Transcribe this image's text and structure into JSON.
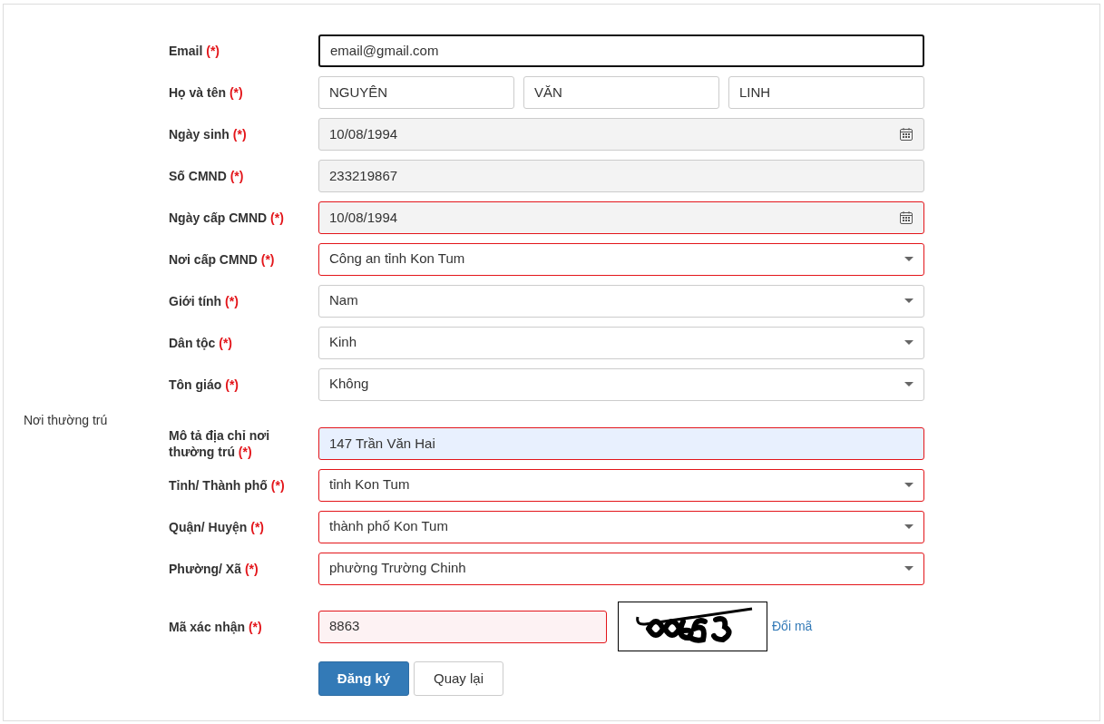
{
  "fields": [
    {
      "kind": "text",
      "label": "Email",
      "required_mark": "(*)",
      "value": "email@gmail.com",
      "focused": true,
      "invalid": false,
      "disabled": false,
      "autofilled": false
    },
    {
      "kind": "name",
      "label": "Họ và tên",
      "required_mark": "(*)",
      "parts": [
        "NGUYÊN",
        "VĂN",
        "LINH"
      ],
      "focused": false,
      "invalid": false,
      "disabled": false,
      "autofilled": false
    },
    {
      "kind": "date",
      "label": "Ngày sinh",
      "required_mark": "(*)",
      "value": "10/08/1994",
      "focused": false,
      "invalid": false,
      "disabled": true,
      "autofilled": false
    },
    {
      "kind": "text",
      "label": "Số CMND",
      "required_mark": "(*)",
      "value": "233219867",
      "focused": false,
      "invalid": false,
      "disabled": true,
      "autofilled": false
    },
    {
      "kind": "date",
      "label": "Ngày cấp CMND",
      "required_mark": "(*)",
      "value": "10/08/1994",
      "focused": false,
      "invalid": true,
      "disabled": true,
      "autofilled": false
    },
    {
      "kind": "select",
      "label": "Nơi cấp CMND",
      "required_mark": "(*)",
      "value": "Công an tỉnh Kon Tum",
      "focused": false,
      "invalid": true,
      "disabled": false,
      "autofilled": false
    },
    {
      "kind": "select",
      "label": "Giới tính",
      "required_mark": "(*)",
      "value": "Nam",
      "focused": false,
      "invalid": false,
      "disabled": false,
      "autofilled": false
    },
    {
      "kind": "select",
      "label": "Dân tộc",
      "required_mark": "(*)",
      "value": "Kinh",
      "focused": false,
      "invalid": false,
      "disabled": false,
      "autofilled": false
    },
    {
      "kind": "select",
      "label": "Tôn giáo",
      "required_mark": "(*)",
      "value": "Không",
      "focused": false,
      "invalid": false,
      "disabled": false,
      "autofilled": false
    }
  ],
  "section": {
    "label": "Nơi thường trú",
    "fields": [
      {
        "kind": "text",
        "label": "Mô tả địa chỉ nơi thường trú",
        "required_mark": "(*)",
        "value": "147 Trần Văn Hai",
        "focused": false,
        "invalid": true,
        "autofilled": true
      },
      {
        "kind": "select",
        "label": "Tỉnh/ Thành phố",
        "required_mark": "(*)",
        "value": "tỉnh Kon Tum",
        "focused": false,
        "invalid": true,
        "disabled": false,
        "autofilled": false
      },
      {
        "kind": "select",
        "label": "Quận/ Huyện",
        "required_mark": "(*)",
        "value": "thành phố Kon Tum",
        "focused": false,
        "invalid": true,
        "disabled": false,
        "autofilled": false
      },
      {
        "kind": "select",
        "label": "Phường/ Xã",
        "required_mark": "(*)",
        "value": "phường Trường Chinh",
        "focused": false,
        "invalid": true,
        "disabled": false,
        "autofilled": false
      }
    ]
  },
  "captcha": {
    "label": "Mã xác nhận",
    "required_mark": "(*)",
    "value": "8863",
    "invalid": true,
    "refresh_link": "Đổi mã"
  },
  "buttons": [
    {
      "label": "Đăng ký",
      "primary": true
    },
    {
      "label": "Quay lại",
      "primary": false
    }
  ]
}
